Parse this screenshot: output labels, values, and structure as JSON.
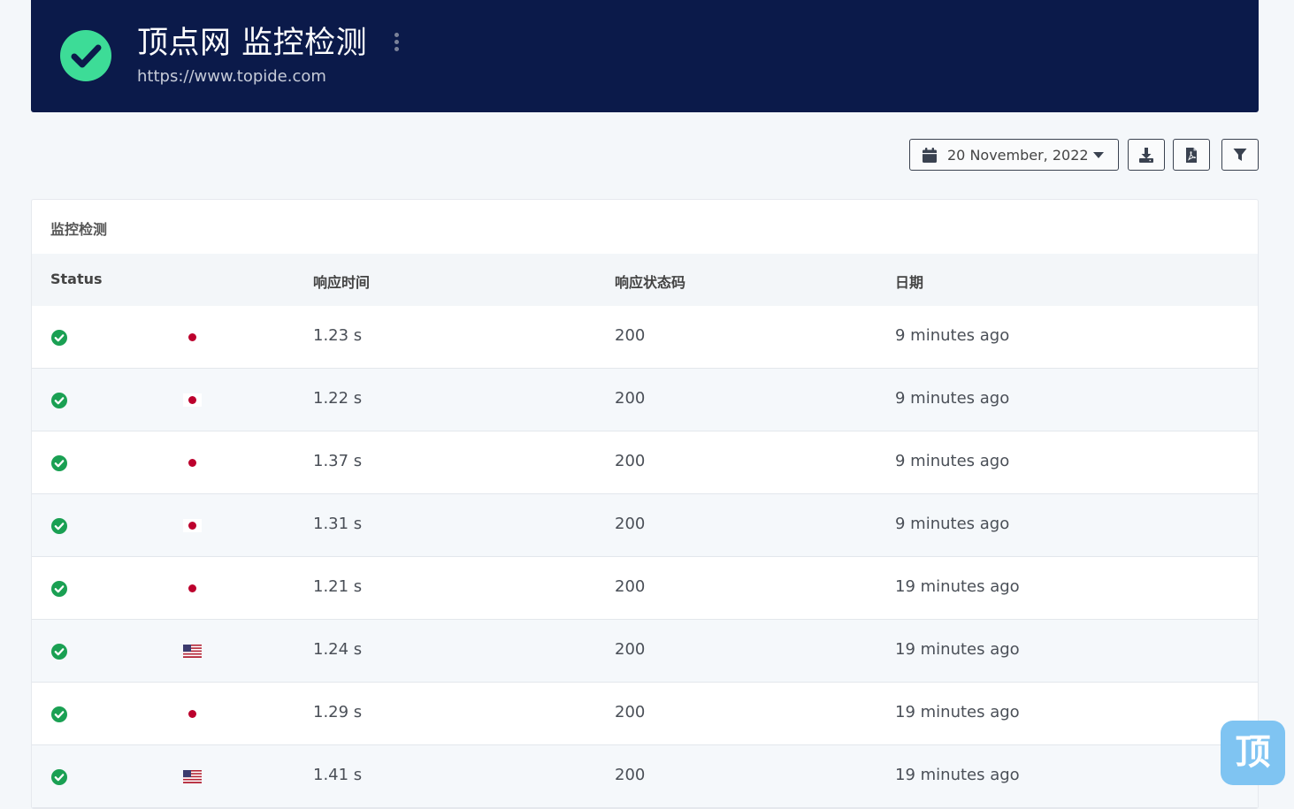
{
  "header": {
    "title": "顶点网 监控检测",
    "url": "https://www.topide.com",
    "status_icon": "check-circle-icon",
    "status_color": "#3ddc97",
    "background": "#0b1a4a"
  },
  "toolbar": {
    "date_label": "20 November, 2022",
    "date_icon": "calendar-icon",
    "buttons": [
      "download-icon",
      "pdf-file-icon",
      "filter-icon"
    ]
  },
  "card": {
    "title": "监控检测",
    "columns": [
      "Status",
      "响应时间",
      "响应状态码",
      "日期"
    ]
  },
  "rows": [
    {
      "status": "check-circle-icon",
      "flag": "japan-flag-icon",
      "response_time": "1.23 s",
      "status_code": "200",
      "date": "9 minutes ago"
    },
    {
      "status": "check-circle-icon",
      "flag": "japan-flag-icon",
      "response_time": "1.22 s",
      "status_code": "200",
      "date": "9 minutes ago"
    },
    {
      "status": "check-circle-icon",
      "flag": "japan-flag-icon",
      "response_time": "1.37 s",
      "status_code": "200",
      "date": "9 minutes ago"
    },
    {
      "status": "check-circle-icon",
      "flag": "japan-flag-icon",
      "response_time": "1.31 s",
      "status_code": "200",
      "date": "9 minutes ago"
    },
    {
      "status": "check-circle-icon",
      "flag": "japan-flag-icon",
      "response_time": "1.21 s",
      "status_code": "200",
      "date": "19 minutes ago"
    },
    {
      "status": "check-circle-icon",
      "flag": "usa-flag-icon",
      "response_time": "1.24 s",
      "status_code": "200",
      "date": "19 minutes ago"
    },
    {
      "status": "check-circle-icon",
      "flag": "japan-flag-icon",
      "response_time": "1.29 s",
      "status_code": "200",
      "date": "19 minutes ago"
    },
    {
      "status": "check-circle-icon",
      "flag": "usa-flag-icon",
      "response_time": "1.41 s",
      "status_code": "200",
      "date": "19 minutes ago"
    }
  ],
  "colors": {
    "success": "#1aa053",
    "japan_red": "#bc002d",
    "usa_red": "#b22234",
    "usa_blue": "#3c3b6e"
  },
  "corner_logo": {
    "text": "顶",
    "color": "#7fc4f2"
  }
}
